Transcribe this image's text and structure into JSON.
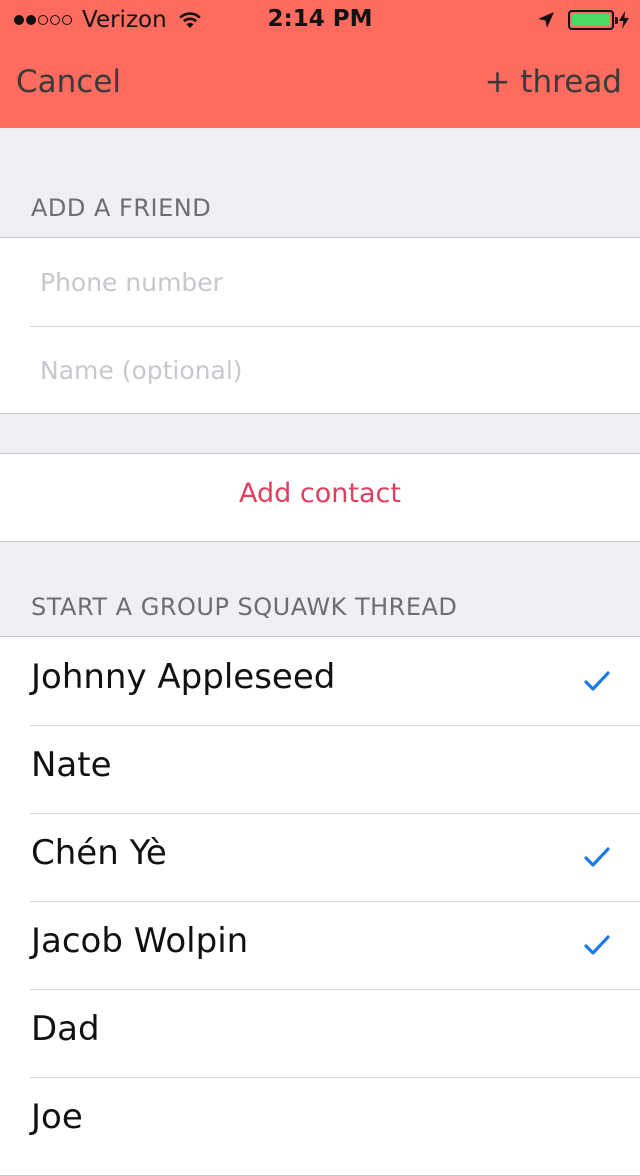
{
  "status_bar": {
    "carrier": "Verizon",
    "time": "2:14 PM",
    "signal_dots_filled": 2,
    "signal_dots_total": 5,
    "battery_level": 1.0
  },
  "nav": {
    "cancel_label": "Cancel",
    "thread_label": "+ thread",
    "background_color": "#ff6b5f"
  },
  "add_friend": {
    "header": "ADD A FRIEND",
    "phone_placeholder": "Phone number",
    "phone_value": "",
    "name_placeholder": "Name (optional)",
    "name_value": ""
  },
  "add_contact": {
    "label": "Add contact",
    "color": "#e0405e"
  },
  "group_thread": {
    "header": "START A GROUP SQUAWK THREAD",
    "contacts": [
      {
        "name": "Johnny Appleseed",
        "selected": true
      },
      {
        "name": "Nate",
        "selected": false
      },
      {
        "name": "Chén Yè",
        "selected": true
      },
      {
        "name": "Jacob Wolpin",
        "selected": true
      },
      {
        "name": "Dad",
        "selected": false
      },
      {
        "name": "Joe",
        "selected": false
      }
    ],
    "check_color": "#1a7cf0"
  },
  "icons": {
    "wifi": "wifi-icon",
    "location": "location-arrow-icon",
    "battery": "battery-icon",
    "charging": "charging-bolt-icon",
    "check": "checkmark-icon"
  }
}
